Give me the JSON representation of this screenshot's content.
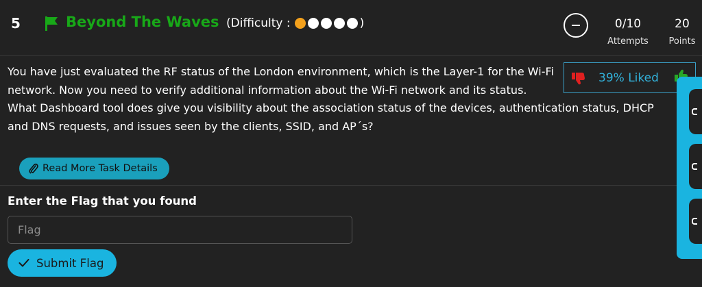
{
  "challenge": {
    "number": "5",
    "title": "Beyond The Waves",
    "difficulty_prefix": "(Difficulty : ",
    "difficulty_suffix": ")",
    "difficulty_level": 1,
    "difficulty_max": 5
  },
  "stats": {
    "attempts_value": "0/10",
    "attempts_label": "Attempts",
    "points_value": "20",
    "points_label": "Points"
  },
  "rating": {
    "liked_text": "39% Liked"
  },
  "description": {
    "paragraph1": "You have just evaluated the RF status of the London environment, which is the Layer-1 for the Wi-Fi network. Now you need to verify additional information about the Wi-Fi network and its status.",
    "paragraph2": "What Dashboard tool does give you visibility about the association status of the devices, authentication status, DHCP and DNS requests, and issues seen by the clients, SSID, and AP´s?"
  },
  "read_more": {
    "label": "Read More Task Details"
  },
  "flag_form": {
    "label": "Enter the Flag that you found",
    "placeholder": "Flag",
    "value": "",
    "submit_label": "Submit Flag"
  },
  "colors": {
    "title_green": "#18a818",
    "accent_cyan": "#1ab4e0",
    "difficulty_filled": "#f4a11c",
    "dislike_red": "#e02020",
    "like_green": "#28a828"
  },
  "icons": {
    "flag": "flag-icon",
    "collapse": "minus-circle-icon",
    "dislike": "thumbs-down-icon",
    "like": "thumbs-up-icon",
    "read_more": "paperclip-icon",
    "submit": "check-icon"
  }
}
